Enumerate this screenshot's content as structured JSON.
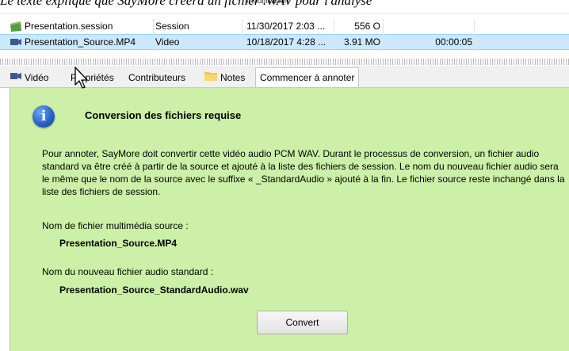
{
  "caption": "Le texte explique que SayMore créera un fichier .WAV pour l'analyse",
  "file_list": {
    "column_header_partial": "modification",
    "rows": [
      {
        "icon": "session-icon",
        "name": "Presentation.session",
        "type": "Session",
        "date": "11/30/2017 2:03 ...",
        "size": "556 O",
        "duration": ""
      },
      {
        "icon": "video-file-icon",
        "name": "Presentation_Source.MP4",
        "type": "Video",
        "date": "10/18/2017 4:28 ...",
        "size": "3.91 MO",
        "duration": "00:00:05",
        "selected": true
      }
    ]
  },
  "tabs": [
    {
      "label": "Vidéo",
      "icon": "video-icon"
    },
    {
      "label": "Propriétés"
    },
    {
      "label": "Contributeurs"
    },
    {
      "label": "Notes",
      "icon": "folder-icon"
    },
    {
      "label": "Commencer à annoter",
      "active": true
    }
  ],
  "panel": {
    "title": "Conversion des fichiers requise",
    "body": "Pour annoter, SayMore doit convertir cette vidéo audio PCM WAV. Durant le processus de conversion, un fichier audio standard va être créé à partir de la source et ajouté à la liste des fichiers de session. Le nom du nouveau fichier audio sera le même que le nom de la source avec le suffixe « _StandardAudio » ajouté à la fin. Le fichier source reste inchangé dans la liste des fichiers de session.",
    "source_label": "Nom de fichier multimédia source :",
    "source_value": "Presentation_Source.MP4",
    "new_label": "Nom du nouveau fichier audio standard :",
    "new_value": "Presentation_Source_StandardAudio.wav",
    "convert_label": "Convert"
  },
  "colors": {
    "panel_bg": "#ccf0a7",
    "selection_bg": "#cce8ff",
    "info_blue": "#2a63c8"
  }
}
